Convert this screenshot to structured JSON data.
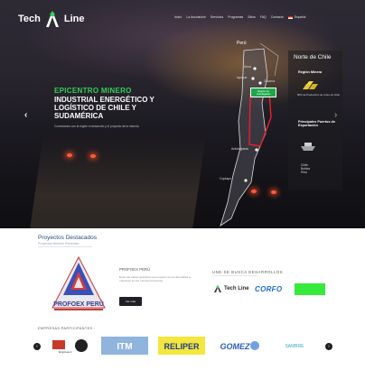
{
  "brand": {
    "name_left": "Tech",
    "name_right": "Line"
  },
  "nav": {
    "items": [
      "Inicio",
      "La Asociación",
      "Servicios",
      "Programas",
      "Sitios",
      "FAQ",
      "Contacto"
    ],
    "language": "Español"
  },
  "hero": {
    "kicker": "EPICENTRO MINERO",
    "headline": "INDUSTRIAL ENERGÉTICO Y LOGÍSTICO DE CHILE Y SUDAMÉRICA",
    "subtitle": "Conectamos con la región el desarrollo y el proyecto de la minería.",
    "arrow_left": "‹",
    "arrow_right": "›"
  },
  "map": {
    "country_label": "Perú",
    "cities": [
      "Arica",
      "Iquique",
      "Calama",
      "Antofagasta",
      "Copiapó"
    ],
    "badge": "Región de Antofagasta"
  },
  "side_panel": {
    "title": "Norte de Chile",
    "mining_label": "Región Minera",
    "mining_note": "50% de Producción de cobre de Chile",
    "exports_label": "Principales Puertos de Exportación",
    "countries": [
      "Chile",
      "Bolivia",
      "Perú"
    ]
  },
  "projects": {
    "title": "Proyectos Destacados",
    "subtitle": "Proyectos Mineros Recientes",
    "item_name": "PROFOEX PERÚ",
    "item_logo_text": "PROFOEX PERÚ",
    "item_desc": "Entre las varias gestiones que pueden ser la alternativa a mantener en los mismos proyectos.",
    "button_label": "Ver más"
  },
  "allies": {
    "title": "UNE-SE BUSCA DESARROLLOS",
    "logo1": "Tech Line",
    "logo2": "CORFO"
  },
  "partners": {
    "title": "EMPRESAS PARTICIPANTES :",
    "items": [
      "Empresa 1",
      "ITM",
      "RELIPER",
      "GOMEZ",
      "SAMBRE"
    ]
  },
  "colors": {
    "accent_green": "#36d05a",
    "badge_green": "#1fa64a",
    "title_blue": "#2b4b7a",
    "corfo_blue": "#1e6bd2"
  }
}
